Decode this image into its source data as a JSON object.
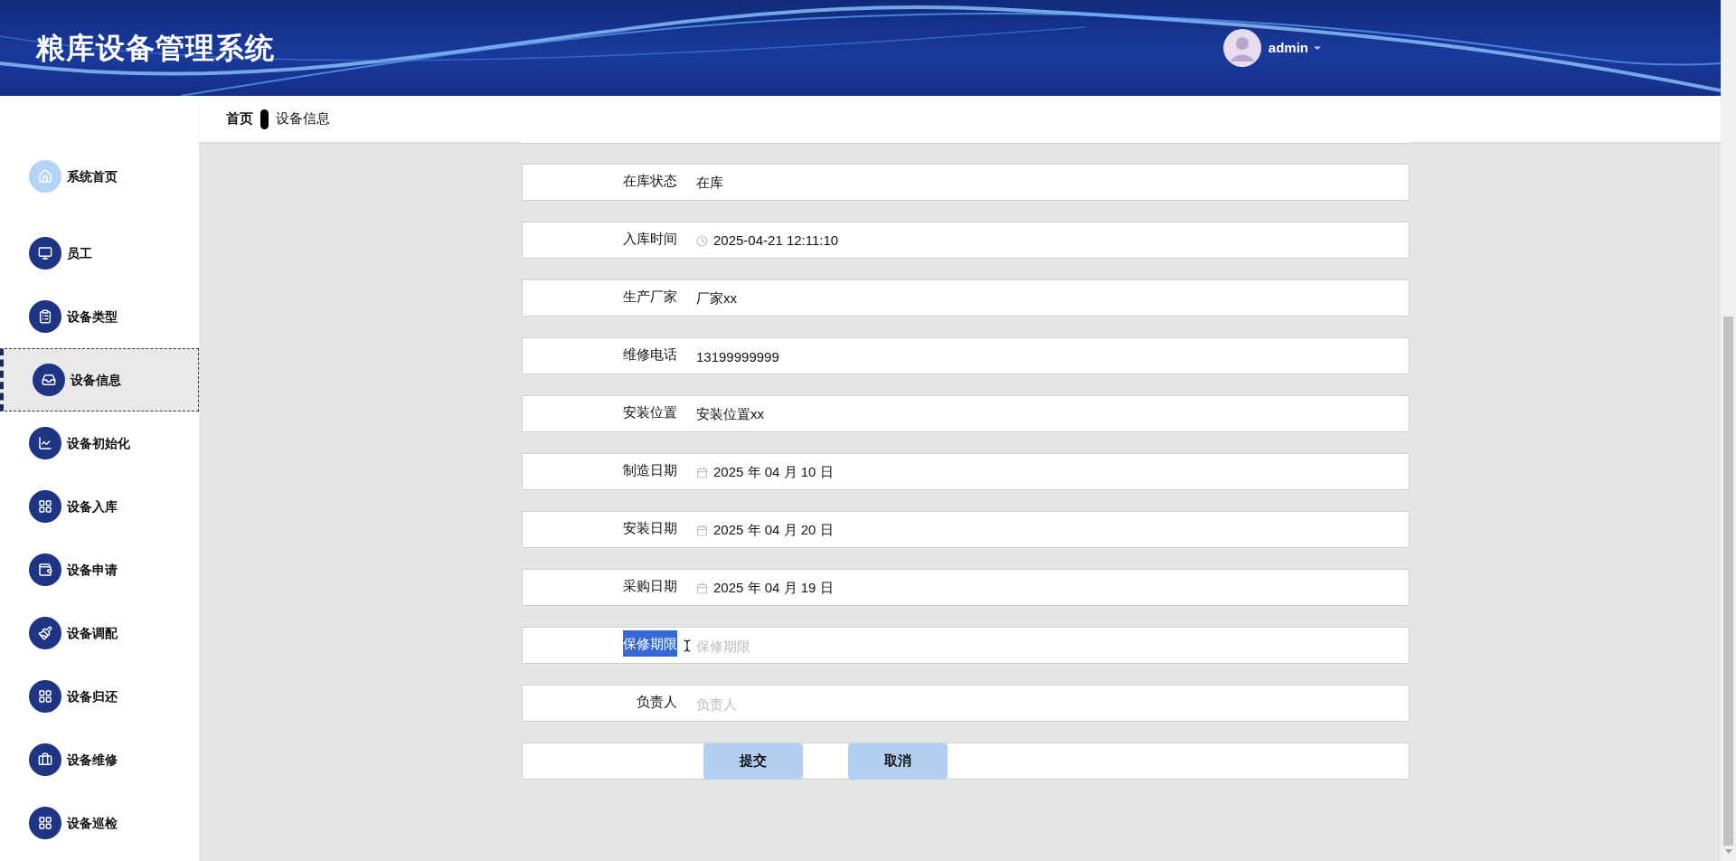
{
  "header": {
    "title": "粮库设备管理系统",
    "user": "admin"
  },
  "breadcrumb": [
    "首页",
    "设备信息"
  ],
  "sidebar": {
    "items": [
      {
        "label": "系统首页",
        "selected": false,
        "kind": "home"
      },
      {
        "label": "员工",
        "selected": false,
        "kind": "menu"
      },
      {
        "label": "设备类型",
        "selected": false,
        "kind": "menu"
      },
      {
        "label": "设备信息",
        "selected": true,
        "kind": "menu"
      },
      {
        "label": "设备初始化",
        "selected": false,
        "kind": "menu"
      },
      {
        "label": "设备入库",
        "selected": false,
        "kind": "menu"
      },
      {
        "label": "设备申请",
        "selected": false,
        "kind": "menu"
      },
      {
        "label": "设备调配",
        "selected": false,
        "kind": "menu"
      },
      {
        "label": "设备归还",
        "selected": false,
        "kind": "menu"
      },
      {
        "label": "设备维修",
        "selected": false,
        "kind": "menu"
      },
      {
        "label": "设备巡检",
        "selected": false,
        "kind": "menu"
      }
    ]
  },
  "form": {
    "fields": [
      {
        "label": "在库状态",
        "kind": "text",
        "value": "在库",
        "highlighted": false
      },
      {
        "label": "入库时间",
        "kind": "datetime",
        "value": "2025-04-21 12:11:10",
        "highlighted": false
      },
      {
        "label": "生产厂家",
        "kind": "input",
        "value": "厂家xx",
        "highlighted": false
      },
      {
        "label": "维修电话",
        "kind": "input",
        "value": "13199999999",
        "highlighted": false
      },
      {
        "label": "安装位置",
        "kind": "input",
        "value": "安装位置xx",
        "highlighted": false
      },
      {
        "label": "制造日期",
        "kind": "date",
        "value": "2025 年 04 月 10 日",
        "highlighted": false
      },
      {
        "label": "安装日期",
        "kind": "date",
        "value": "2025 年 04 月 20 日",
        "highlighted": false
      },
      {
        "label": "采购日期",
        "kind": "date",
        "value": "2025 年 04 月 19 日",
        "highlighted": false
      },
      {
        "label": "保修期限",
        "kind": "input",
        "placeholder": "保修期限",
        "highlighted": true
      },
      {
        "label": "负责人",
        "kind": "input",
        "placeholder": "负责人",
        "highlighted": false
      }
    ],
    "buttons": [
      "提交",
      "取消"
    ]
  }
}
